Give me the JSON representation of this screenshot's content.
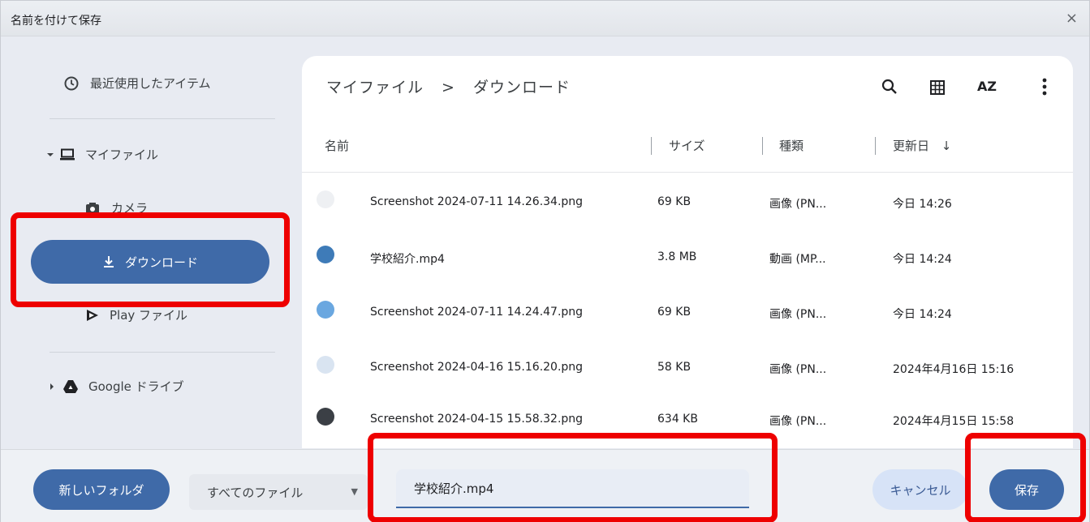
{
  "dialog": {
    "title": "名前を付けて保存",
    "close_glyph": "×"
  },
  "sidebar": {
    "recent_label": "最近使用したアイテム",
    "my_files_label": "マイファイル",
    "camera_label": "カメラ",
    "downloads_label": "ダウンロード",
    "play_files_label": "Play ファイル",
    "google_drive_label": "Google ドライブ"
  },
  "breadcrumb": {
    "root": "マイファイル",
    "separator": ">",
    "current": "ダウンロード"
  },
  "toolbar": {
    "search_icon": "search-icon",
    "grid_icon": "grid-view-icon",
    "sort_label": "AZ",
    "more_icon": "more-vert-icon"
  },
  "columns": {
    "name": "名前",
    "size": "サイズ",
    "type": "種類",
    "modified": "更新日",
    "sort_arrow": "↓"
  },
  "files": [
    {
      "name": "Screenshot 2024-07-11 14.26.34.png",
      "size": "69 KB",
      "type": "画像 (PN...",
      "modified": "今日 14:26",
      "thumb_color": "#eef0f3"
    },
    {
      "name": "学校紹介.mp4",
      "size": "3.8 MB",
      "type": "動画 (MP...",
      "modified": "今日 14:24",
      "thumb_color": "#3e7bb8"
    },
    {
      "name": "Screenshot 2024-07-11 14.24.47.png",
      "size": "69 KB",
      "type": "画像 (PN...",
      "modified": "今日 14:24",
      "thumb_color": "#6aa7e0"
    },
    {
      "name": "Screenshot 2024-04-16 15.16.20.png",
      "size": "58 KB",
      "type": "画像 (PN...",
      "modified": "2024年4月16日 15:16",
      "thumb_color": "#d9e4f1"
    },
    {
      "name": "Screenshot 2024-04-15 15.58.32.png",
      "size": "634 KB",
      "type": "画像 (PN...",
      "modified": "2024年4月15日 15:58",
      "thumb_color": "#3b3f45"
    }
  ],
  "bottom": {
    "new_folder_label": "新しいフォルダ",
    "file_type_value": "すべてのファイル",
    "filename_value": "学校紹介.mp4",
    "cancel_label": "キャンセル",
    "save_label": "保存"
  },
  "colors": {
    "accent": "#3f6aa8",
    "highlight": "#ee0000"
  }
}
